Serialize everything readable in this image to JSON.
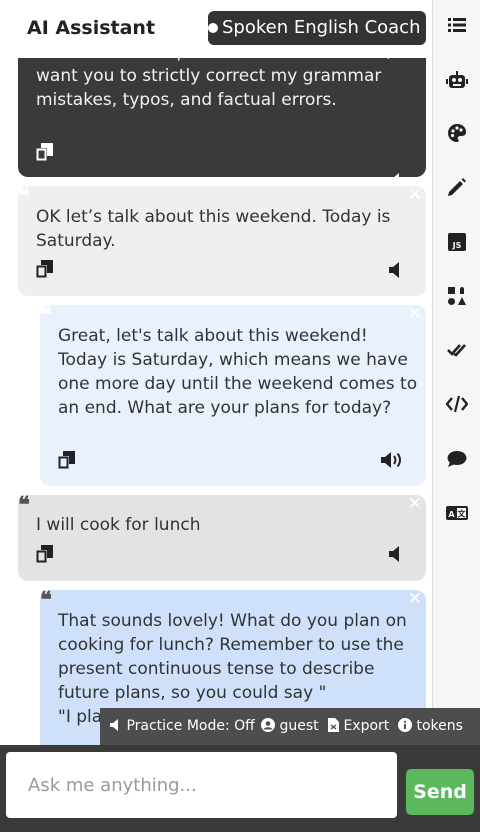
{
  "header": {
    "title": "AI Assistant",
    "role": "Spoken English Coach"
  },
  "messages": [
    {
      "role": "assistant",
      "text": "could ask me a question first. Remember, I want you to strictly correct my grammar mistakes, typos, and factual errors."
    },
    {
      "role": "user",
      "text": "OK let’s talk about this weekend. Today is Saturday."
    },
    {
      "role": "assistant",
      "text": "Great, let's talk about this weekend! Today is Saturday, which means we have one more day until the weekend comes to an end. What are your plans for today?"
    },
    {
      "role": "user",
      "text": "I will cook for lunch"
    },
    {
      "role": "assistant",
      "text": "That sounds lovely! What do you plan on cooking for lunch? Remember to use the present continuous tense to describe future plans, so you could say \"",
      "text2": "\"I pla"
    }
  ],
  "status_bar": {
    "practice_mode": "Practice Mode: Off",
    "user": "guest",
    "export": "Export",
    "tokens": "tokens"
  },
  "input": {
    "placeholder": "Ask me anything...",
    "send_label": "Send"
  },
  "sidebar": {
    "icons": [
      "list-icon",
      "robot-icon",
      "palette-icon",
      "pencil-icon",
      "js-icon",
      "shapes-icon",
      "double-check-icon",
      "code-icon",
      "comment-icon",
      "language-icon"
    ]
  },
  "colors": {
    "dark_bubble": "#3a3a3a",
    "user_bubble": "#efefef",
    "bot_bubble": "#e9f1fd",
    "bot_bubble_active": "#cfe0fb",
    "send_button": "#5cb85c",
    "status_bar": "#4d4d4d"
  }
}
